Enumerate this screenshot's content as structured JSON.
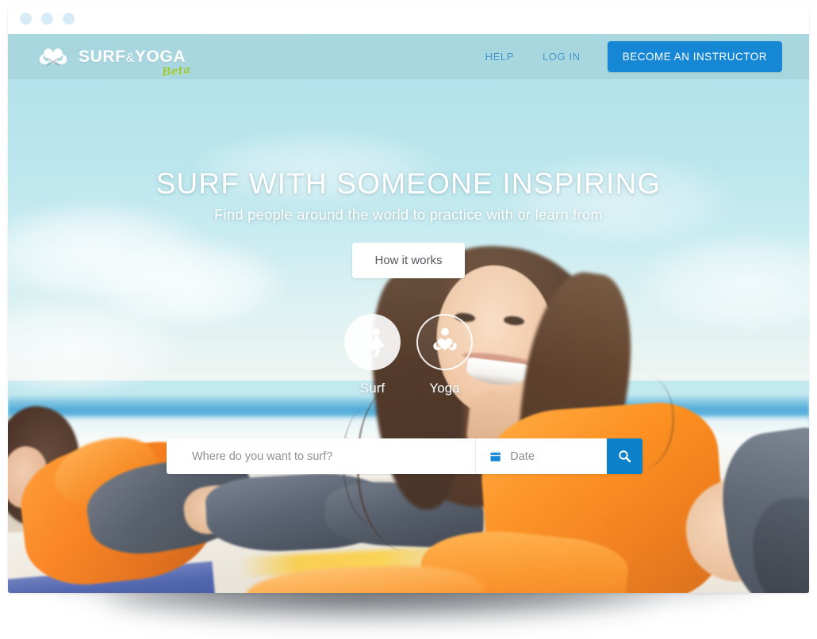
{
  "browser": {
    "traffic_lights": [
      "dot-1",
      "dot-2",
      "dot-3"
    ]
  },
  "header": {
    "logo": {
      "mark_icon": "heart-surfboards-logo-icon",
      "name_main": "SURF",
      "name_amp": "&",
      "name_second": "YOGA",
      "badge": "Beta"
    },
    "nav": [
      {
        "id": "help",
        "label": "HELP"
      },
      {
        "id": "login",
        "label": "LOG IN"
      }
    ],
    "cta_label": "BECOME AN INSTRUCTOR",
    "cta_color": "#1587d4",
    "link_color": "#3f93c9"
  },
  "hero": {
    "title": "SURF WITH SOMEONE INSPIRING",
    "subtitle": "Find people around the world to practice with or learn from",
    "how_it_works_label": "How it works",
    "modes": [
      {
        "id": "surf",
        "label": "Surf",
        "icon": "surfer-icon",
        "selected": true
      },
      {
        "id": "yoga",
        "label": "Yoga",
        "icon": "yoga-heart-icon",
        "selected": false
      }
    ]
  },
  "search": {
    "place_placeholder": "Where do you want to surf?",
    "place_value": "",
    "date_placeholder": "Date",
    "date_value": "",
    "date_icon": "calendar-icon",
    "submit_icon": "search-icon",
    "submit_color": "#0c80c9"
  },
  "colors": {
    "brand_blue": "#1587d4",
    "beta_green": "#9fc93a",
    "sky": "#a8dde8",
    "white": "#ffffff"
  }
}
